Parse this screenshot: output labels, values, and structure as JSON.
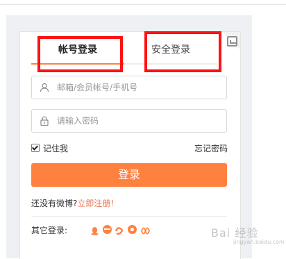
{
  "tabs": {
    "account_label": "帐号登录",
    "safe_label": "安全登录"
  },
  "username": {
    "placeholder": "邮箱/会员帐号/手机号",
    "icon": "user-icon"
  },
  "password": {
    "placeholder": "请输入密码",
    "icon": "lock-icon"
  },
  "remember": {
    "label": "记住我",
    "checked": true
  },
  "forgot_label": "忘记密码",
  "login_button": "登录",
  "register": {
    "prompt": "还没有微博?",
    "link": "立即注册!"
  },
  "other_login": {
    "label": "其它登录:",
    "icons": [
      "qq-icon",
      "ball-icon",
      "sohu-icon",
      "browser-icon",
      "unionpay-icon"
    ]
  },
  "watermark": {
    "text": "Bai 经验",
    "sub": "jingyan.baidu.com"
  },
  "colors": {
    "accent": "#ff8140",
    "link": "#eb7350",
    "highlight": "#ff1111",
    "panel": "#eef0f3"
  }
}
